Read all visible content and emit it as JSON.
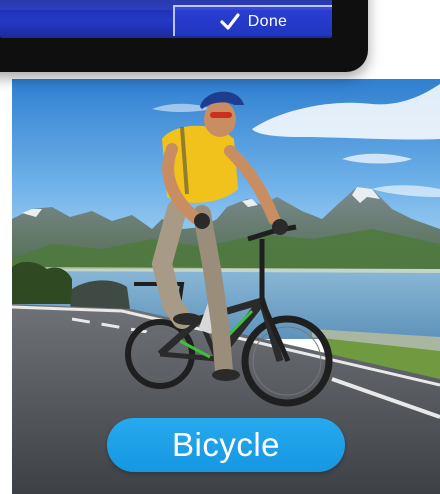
{
  "header": {
    "done_label": "Done",
    "done_icon": "checkmark-icon"
  },
  "photo": {
    "subject": "cyclist-on-bicycle"
  },
  "label": {
    "text": "Bicycle"
  },
  "colors": {
    "screen_blue": "#2538c7",
    "pill_blue": "#1a9be6",
    "jersey_yellow": "#f1c21b",
    "bike_green": "#3fbf3a"
  }
}
